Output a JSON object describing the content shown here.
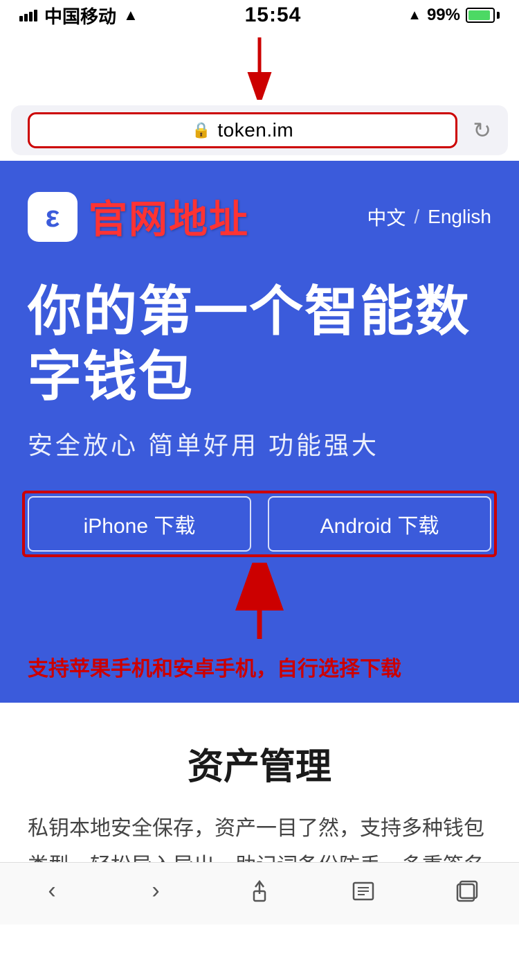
{
  "statusBar": {
    "carrier": "中国移动",
    "time": "15:54",
    "battery": "99%"
  },
  "browserBar": {
    "url": "token.im",
    "refreshIcon": "↻"
  },
  "siteHeader": {
    "logoIcon": "ε",
    "title": "官网地址",
    "langChinese": "中文",
    "langDivider": "/",
    "langEnglish": "English"
  },
  "hero": {
    "title": "你的第一个智能数\n字钱包",
    "subtitle": "安全放心  简单好用  功能强大"
  },
  "downloadButtons": {
    "iphone": "iPhone 下载",
    "android": "Android 下载"
  },
  "annotationText": "支持苹果手机和安卓手机，自行选择下载",
  "contentSection": {
    "title": "资产管理",
    "body": "私钥本地安全保存，资产一目了然，支持多种钱包类型，轻松导入导出，助记词备份防丢，多重签名防盗"
  },
  "bottomNav": {
    "back": "‹",
    "forward": "›",
    "share": "↑",
    "bookmarks": "⊟",
    "tabs": "⧉"
  }
}
